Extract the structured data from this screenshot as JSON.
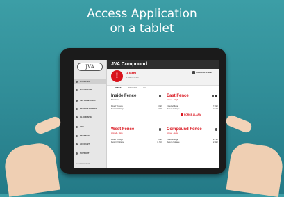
{
  "headline": {
    "line1": "Access Application",
    "line2": "on a tablet"
  },
  "app": {
    "logo": "JVA",
    "title": "JVA Compound"
  },
  "sidebar": {
    "items": [
      {
        "label": "OVERVIEW",
        "icon": "overview-icon",
        "active": true
      },
      {
        "label": "DASHBOARD",
        "icon": "dashboard-icon",
        "active": false
      },
      {
        "label": "JVA COMPOUND",
        "icon": "location-pin-icon",
        "active": false
      },
      {
        "label": "DETROIT BORDER",
        "icon": "location-pin-icon",
        "active": false
      },
      {
        "label": "CLOUD SITE",
        "icon": "location-pin-icon",
        "active": false
      },
      {
        "label": "LOG",
        "icon": "log-icon",
        "active": false
      },
      {
        "label": "SETTINGS",
        "icon": "gear-icon",
        "active": false
      },
      {
        "label": "ACCOUNT",
        "icon": "user-icon",
        "active": false
      },
      {
        "label": "SUPPORT",
        "icon": "help-icon",
        "active": false
      }
    ],
    "footer": "CLOUD CLIENT"
  },
  "alarm": {
    "icon": "!",
    "title": "Alarm",
    "subtitle": "2 Alarms Active",
    "right_label": "SUPPRESS ALARMS"
  },
  "tabs": [
    {
      "label": "ZONES",
      "active": true
    },
    {
      "label": "DEVICES",
      "active": false
    },
    {
      "label": "I/O",
      "active": false
    }
  ],
  "zones": [
    {
      "name": "Inside Fence",
      "status": "Disarmed",
      "status_color": "#333333",
      "rows": [
        {
          "label": "Fixed Voltage",
          "value": "0.0kV"
        },
        {
          "label": "Return Voltage",
          "value": "0.0kV"
        }
      ]
    },
    {
      "name": "East Fence",
      "status": "Armed - High",
      "status_color": "#d9121b",
      "rows": [
        {
          "label": "Fixed Voltage",
          "value": "7.0kV"
        },
        {
          "label": "Return Voltage",
          "value": "2.1kV"
        }
      ],
      "action": "FORCE ALARM"
    },
    {
      "name": "West Fence",
      "status": "Armed - High",
      "status_color": "#d9121b",
      "rows": [
        {
          "label": "Fixed Voltage",
          "value": "9.0kV"
        },
        {
          "label": "Return Voltage",
          "value": "8.7 kv"
        }
      ]
    },
    {
      "name": "Compound Fence",
      "status": "Armed - Low",
      "status_color": "#d9121b",
      "rows": [
        {
          "label": "Fixed Voltage",
          "value": "2.7kV"
        },
        {
          "label": "Return Voltage",
          "value": "2.4kV"
        }
      ]
    }
  ],
  "colors": {
    "accent": "#d9121b",
    "titlebar": "#2e2e2e",
    "background": "#2f8b96"
  }
}
